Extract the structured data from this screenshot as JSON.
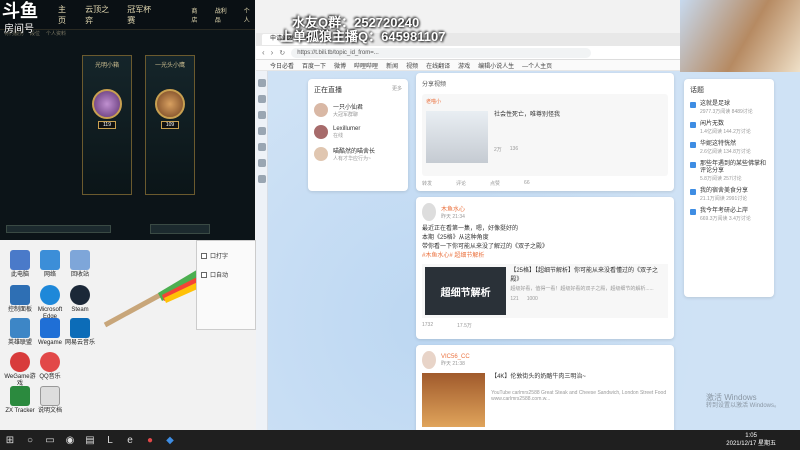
{
  "stream": {
    "logo": "斗鱼",
    "logo_sub": "房间号",
    "qq_group": "水友Q群：252720240",
    "host_qq": "上单孤狼主播Q：645981107"
  },
  "game": {
    "nav": [
      "主页",
      "云顶之弈",
      "冠军杯赛"
    ],
    "nav_right": [
      "商店",
      "战利品",
      "个人"
    ],
    "subnav": [
      "特约服务",
      "段位",
      "个人资料"
    ],
    "cards": [
      {
        "title": "光明小箱",
        "level": "119"
      },
      {
        "title": "一光头小鹰",
        "level": "109"
      }
    ]
  },
  "browser": {
    "tab": "申请停发等验证码",
    "url": "https://t.bili.tb/topic_id_from=...",
    "bookmarks": [
      "今日必看",
      "百度一下",
      "微博",
      "哔哩哔哩",
      "新闻",
      "视频",
      "在线翻译",
      "游戏",
      "编辑小说人生",
      "—个人主页"
    ],
    "live": {
      "title": "正在直播",
      "more": "更多",
      "items": [
        {
          "name": "一只小仙君",
          "desc": "大冠军群聊"
        },
        {
          "name": "Lexillumer",
          "desc": "在线"
        },
        {
          "name": "喵酷然的喵舍长",
          "desc": "人有才华应行为~"
        }
      ]
    },
    "post0": {
      "label": "分享视频",
      "user": "老喵小",
      "text": "社会性死亡，唯尊别怪我",
      "stats": [
        "2万",
        "136"
      ],
      "actions": [
        "转发",
        "评论",
        "点赞",
        "66"
      ]
    },
    "post1": {
      "user": "木鱼水心",
      "time": "昨天 21:34",
      "lines": [
        "最近正在看第一集，嗯，好像挺好的",
        "本期《25格》从这种角度",
        "带你看一下你可能从来没了解过的《双子之殿》"
      ],
      "tag": "#木鱼水心# 超细节解析",
      "video_title": "【25格】【超细节解析】你可能从来没看懂过的《双子之殿》",
      "video_desc": "超级好看，值得一看！超级好看的双子之殿，超级细节的解析......",
      "overlay": "超细节解析",
      "stats": [
        "121",
        "1000"
      ],
      "actions": [
        "1732",
        "17.5万"
      ]
    },
    "post2": {
      "user": "VIC56_CC",
      "time": "昨天 21:38",
      "video_title": "【4K】伦敦街头的奶酪牛肉三明治~",
      "video_desc": "YouTube carlmrs2588 Great Steak and Cheese Sandwich, London Street Food www.carlmrs2588.com.w..."
    },
    "topics": {
      "title": "话题",
      "items": [
        {
          "title": "这就是足球",
          "count": "2977.3万阅读 8489讨论"
        },
        {
          "title": "闲片无数",
          "count": "1.4亿阅读 144.2万讨论"
        },
        {
          "title": "华妮这特恍然",
          "count": "2.6亿阅读 134.8万讨论"
        },
        {
          "title": "那些年遇到的某些佛掌和评论分享",
          "count": "5.8万阅读 257讨论"
        },
        {
          "title": "我的宿舍美食分享",
          "count": "21.1万阅读 2991讨论"
        },
        {
          "title": "我今年考研必上岸",
          "count": "669.3万阅读 3.4万讨论"
        }
      ]
    }
  },
  "desktop": {
    "icons": [
      "此电脑",
      "网络",
      "回收站",
      "控制面板",
      "Microsoft Edge",
      "Steam",
      "英雄联盟",
      "Wegame",
      "网易云音乐",
      "WeGame游戏",
      "QQ音乐",
      "ZX Tracker",
      "说明文档"
    ]
  },
  "dialog": {
    "rows": [
      "口打字",
      "口自动"
    ]
  },
  "system": {
    "activate_line1": "激活 Windows",
    "activate_line2": "转到设置以激活 Windows。",
    "time": "1:05",
    "date": "2021/12/17 星期五"
  }
}
